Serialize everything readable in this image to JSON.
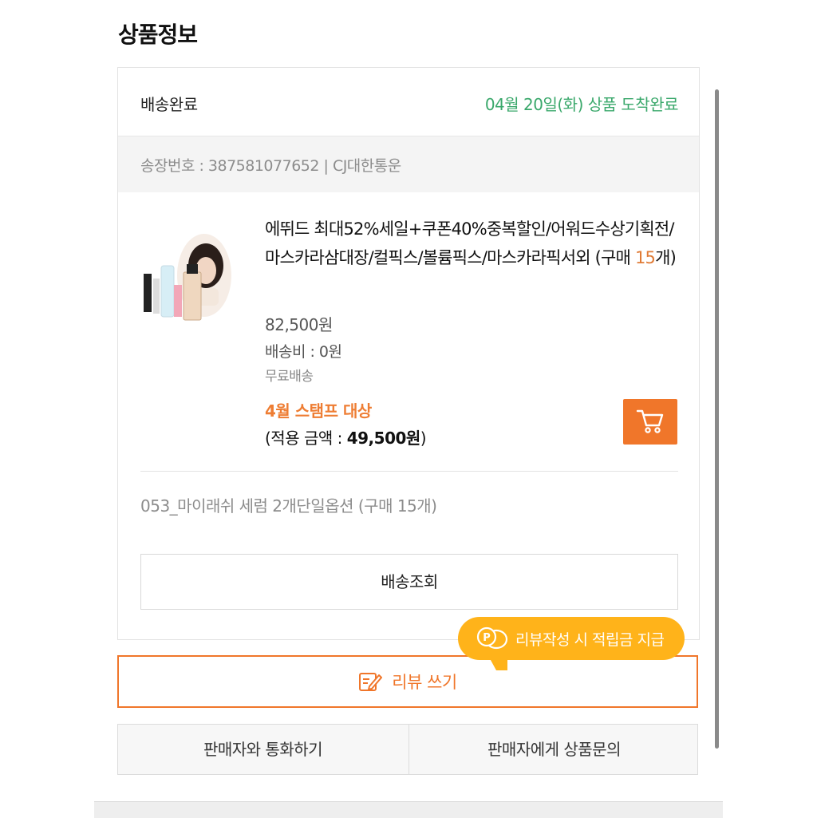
{
  "section_title": "상품정보",
  "order": {
    "status": "배송완료",
    "arrival_text": "04월 20일(화) 상품 도착완료",
    "invoice_text": "송장번호 : 387581077652 |  CJ대한통운"
  },
  "product": {
    "title": "에뛰드 최대52%세일+쿠폰40%중복할인/어워드수상기획전/마스카라삼대장/컬픽스/볼륨픽스/마스카라픽서외 (구매 ",
    "qty_number": "15",
    "title_suffix": "개)",
    "price": "82,500원",
    "shipping_fee": "배송비 : 0원",
    "shipping_type": "무료배송",
    "stamp_label": "4월 스탬프 대상",
    "applied_prefix": "(적용 금액 : ",
    "applied_amount": "49,500원",
    "applied_suffix": ")",
    "option_text": "053_마이래쉬 세럼 2개단일옵션 (구매 15개)"
  },
  "buttons": {
    "track": "배송조회",
    "review": "리뷰 쓰기",
    "call_seller": "판매자와 통화하기",
    "ask_seller": "판매자에게 상품문의"
  },
  "tooltip": {
    "text": "리뷰작성 시 적립금 지급"
  },
  "icons": {
    "cart": "cart-icon",
    "review": "pencil-note-icon",
    "points": "point-coin-icon"
  },
  "colors": {
    "accent_orange": "#f0762a",
    "arrival_green": "#3aa86b",
    "tooltip_yellow": "#ffb31a"
  }
}
